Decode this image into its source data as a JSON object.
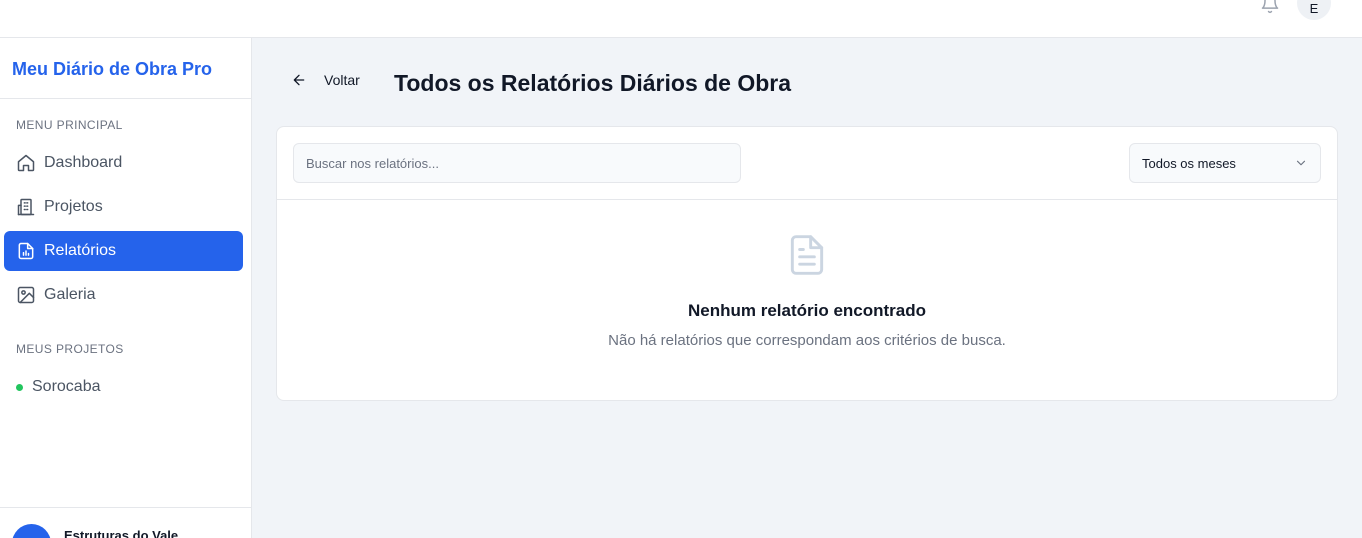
{
  "topbar": {
    "notifications_icon": "bell-icon",
    "user_initial": "E"
  },
  "sidebar": {
    "brand": "Meu Diário de Obra Pro",
    "menu_section": "MENU PRINCIPAL",
    "items": [
      {
        "label": "Dashboard",
        "icon": "home-icon"
      },
      {
        "label": "Projetos",
        "icon": "building-icon"
      },
      {
        "label": "Relatórios",
        "icon": "report-icon",
        "active": true
      },
      {
        "label": "Galeria",
        "icon": "image-icon"
      }
    ],
    "projects_section": "MEUS PROJETOS",
    "projects": [
      {
        "label": "Sorocaba",
        "status_color": "#22c55e"
      }
    ],
    "footer": {
      "user_name": "Estruturas do Vale"
    }
  },
  "header": {
    "back_label": "Voltar",
    "title": "Todos os Relatórios Diários de Obra"
  },
  "filters": {
    "search_placeholder": "Buscar nos relatórios...",
    "search_value": "",
    "month_select": "Todos os meses"
  },
  "empty_state": {
    "icon": "document-icon",
    "title": "Nenhum relatório encontrado",
    "message": "Não há relatórios que correspondam aos critérios de busca."
  },
  "colors": {
    "accent": "#2563eb",
    "background": "#f1f4f8",
    "status_active": "#22c55e"
  }
}
